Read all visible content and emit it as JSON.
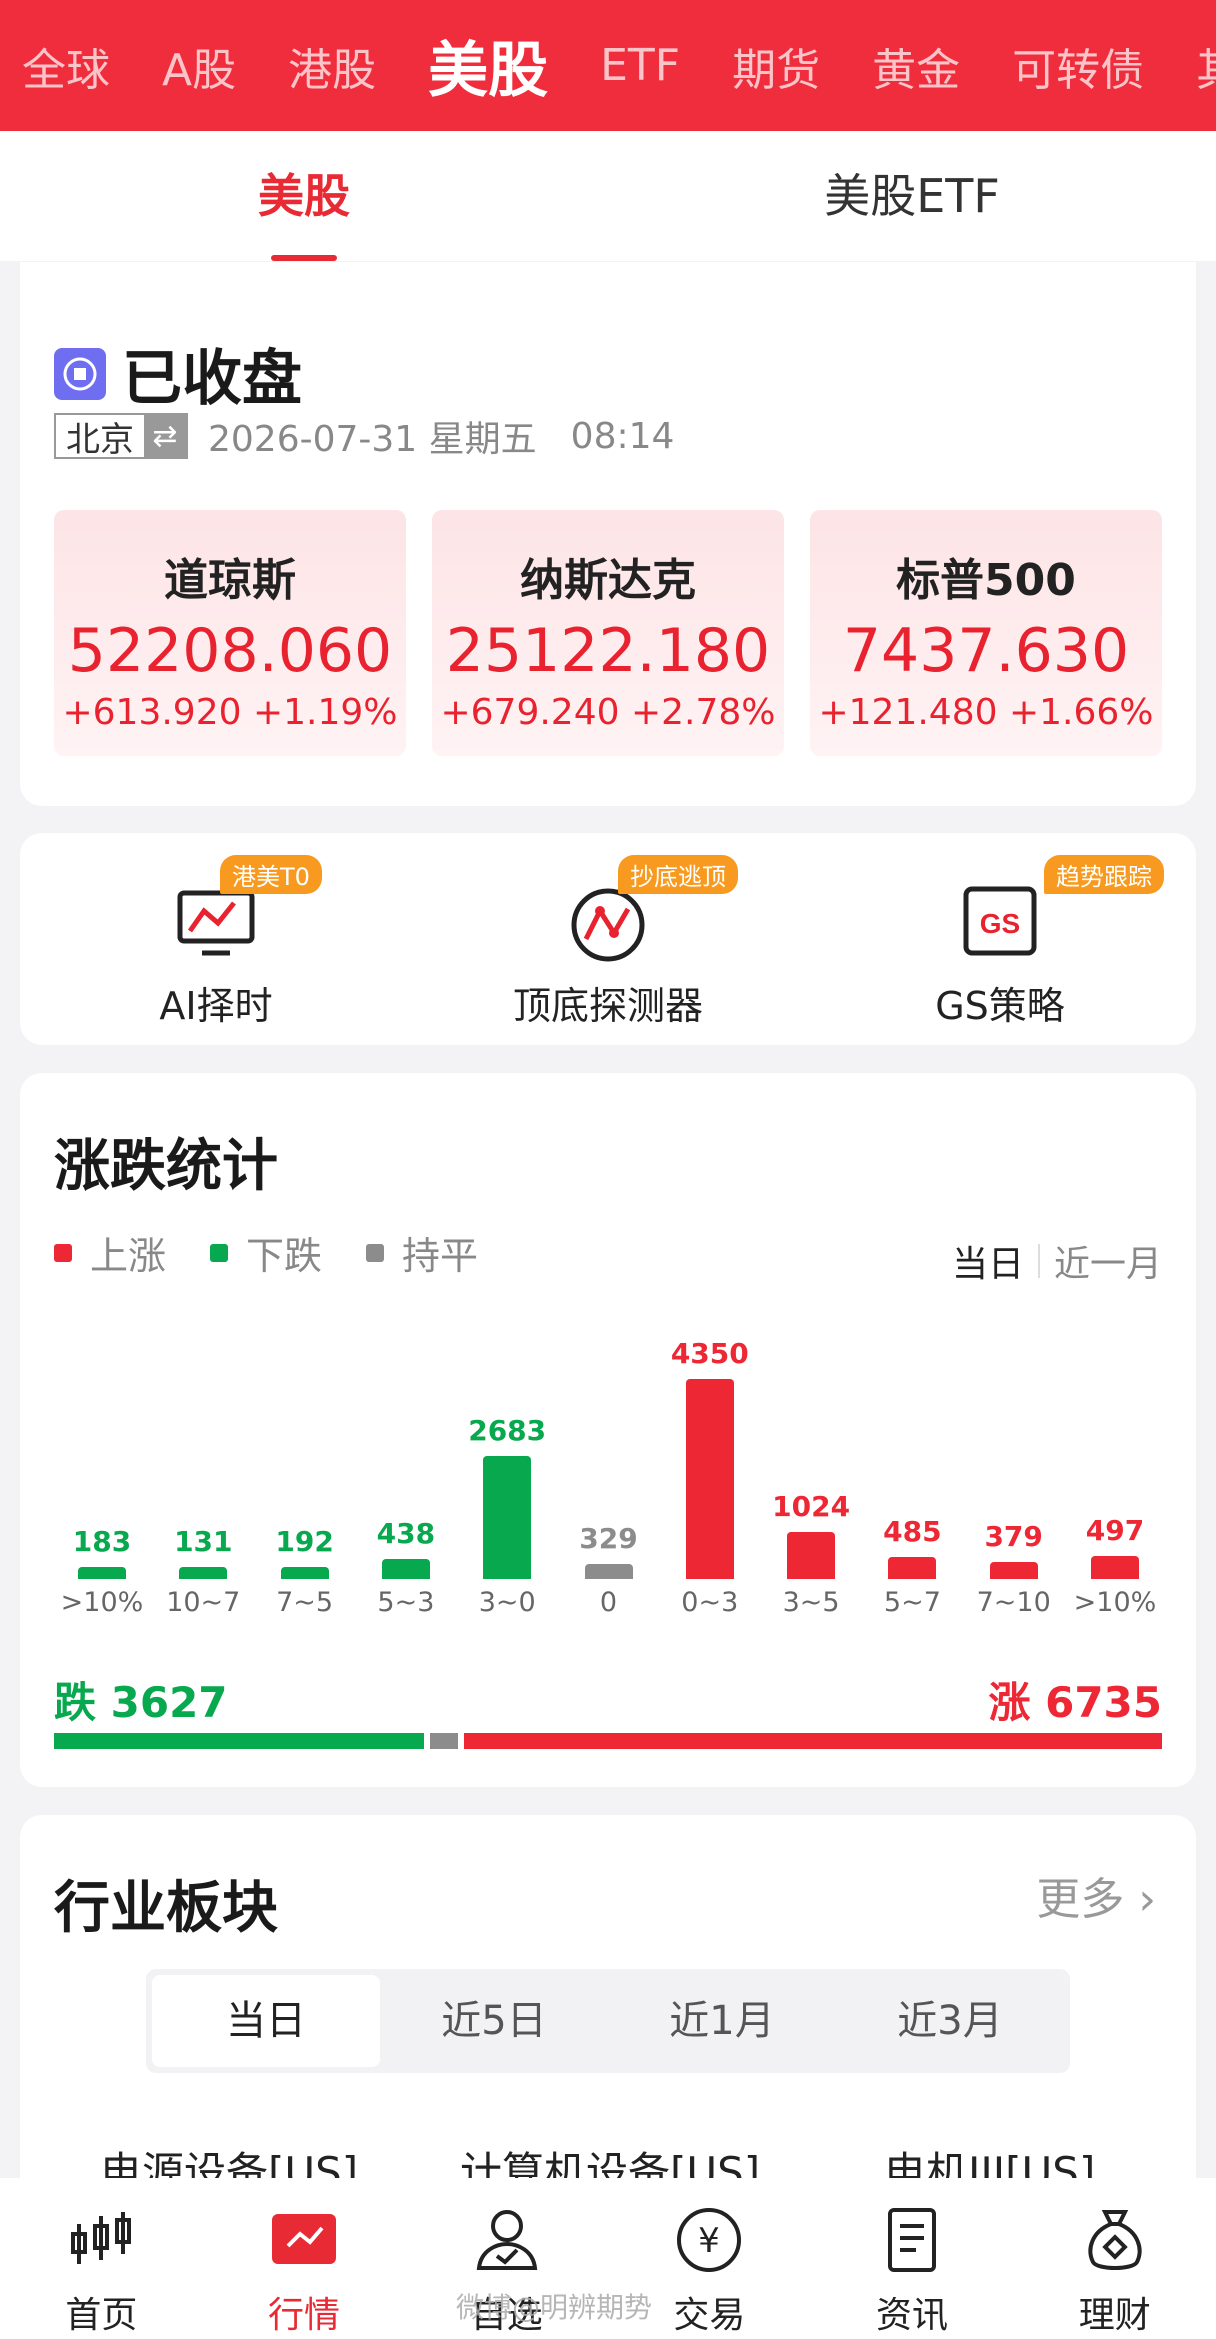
{
  "market_tabs": [
    "全球",
    "A股",
    "港股",
    "美股",
    "ETF",
    "期货",
    "黄金",
    "可转债",
    "其"
  ],
  "sub_tabs": [
    "美股",
    "美股ETF"
  ],
  "status": {
    "text": "已收盘",
    "city": "北京",
    "swap_icon": "⇄",
    "date": "2026-07-31 星期五",
    "time": "08:14"
  },
  "indices": [
    {
      "name": "道琼斯",
      "value": "52208.060",
      "change": "+613.920",
      "pct": "+1.19%"
    },
    {
      "name": "纳斯达克",
      "value": "25122.180",
      "change": "+679.240",
      "pct": "+2.78%"
    },
    {
      "name": "标普500",
      "value": "7437.630",
      "change": "+121.480",
      "pct": "+1.66%"
    }
  ],
  "tools": [
    {
      "label": "AI择时",
      "badge": "港美T0",
      "icon": "monitor-chart-icon"
    },
    {
      "label": "顶底探测器",
      "badge": "抄底逃顶",
      "icon": "wave-detector-icon"
    },
    {
      "label": "GS策略",
      "badge": "趋势跟踪",
      "icon": "gs-monitor-icon"
    }
  ],
  "stats": {
    "title": "涨跌统计",
    "legend": [
      "上涨",
      "下跌",
      "持平"
    ],
    "range": [
      "当日",
      "近一月"
    ],
    "fall_label": "跌 3627",
    "rise_label": "涨 6735"
  },
  "colors": {
    "up": "#ee2735",
    "down": "#08a84f",
    "flat": "#8c8c8c",
    "brand": "#f02d3c"
  },
  "chart_data": {
    "type": "bar",
    "title": "涨跌统计",
    "categories": [
      ">10%",
      "10~7",
      "7~5",
      "5~3",
      "3~0",
      "0",
      "0~3",
      "3~5",
      "5~7",
      "7~10",
      ">10%"
    ],
    "values": [
      183,
      131,
      192,
      438,
      2683,
      329,
      4350,
      1024,
      485,
      379,
      497
    ],
    "labels": [
      "183",
      "131",
      "192",
      "438",
      "2683",
      "329",
      "4350",
      "1024",
      "485",
      "379",
      "497"
    ],
    "groups": [
      "down",
      "down",
      "down",
      "down",
      "down",
      "flat",
      "up",
      "up",
      "up",
      "up",
      "up"
    ],
    "summary": {
      "down": 3627,
      "up": 6735,
      "flat": 329
    },
    "legend": [
      "上涨",
      "下跌",
      "持平"
    ]
  },
  "industry": {
    "title": "行业板块",
    "more": "更多",
    "periods": [
      "当日",
      "近5日",
      "近1月",
      "近3月"
    ],
    "items": [
      "电源设备[US]",
      "计算机设备[US]",
      "电机III[US]"
    ]
  },
  "bottom_nav": [
    "首页",
    "行情",
    "自选",
    "交易",
    "资讯",
    "理财"
  ],
  "watermark": "微博@明辨期势"
}
